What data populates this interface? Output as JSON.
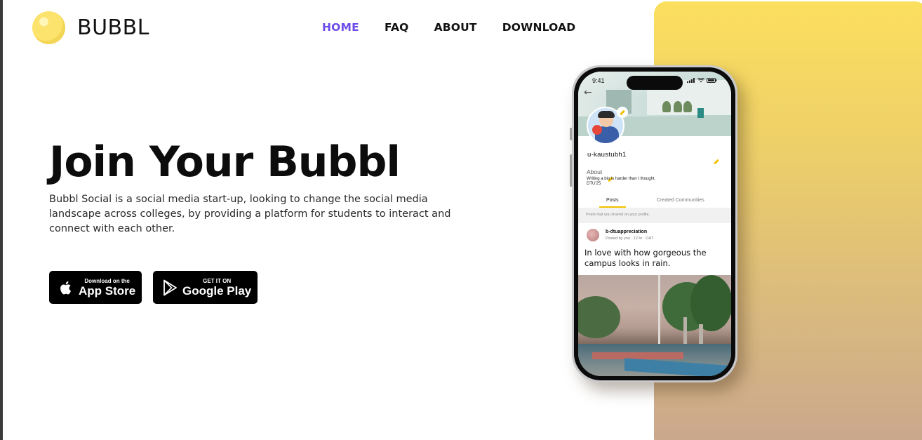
{
  "brand": {
    "name": "BUBBL",
    "accent": "#6c4be8",
    "panel_top": "#fbdf5e",
    "panel_bottom": "#c9a68e"
  },
  "nav": {
    "items": [
      {
        "label": "HOME",
        "active": true
      },
      {
        "label": "FAQ",
        "active": false
      },
      {
        "label": "ABOUT",
        "active": false
      },
      {
        "label": "DOWNLOAD",
        "active": false
      }
    ]
  },
  "hero": {
    "title": "Join Your Bubbl",
    "description": "Bubbl Social is a social media start-up, looking to change the social media landscape across colleges, by providing a platform for students to interact and connect with each other."
  },
  "stores": {
    "apple": {
      "small": "Download on the",
      "big": "App Store",
      "icon": "apple-icon"
    },
    "google": {
      "small": "GET IT ON",
      "big": "Google Play",
      "icon": "google-play-icon"
    }
  },
  "phone": {
    "status_time": "9:41",
    "username": "u-kaustubh1",
    "about_label": "About",
    "bio_line1": "Writing a bio is harder than I thought.",
    "bio_line2": "DTU'25",
    "tabs": {
      "posts": "Posts",
      "communities": "Created Communities"
    },
    "tab_hint": "Posts that you shared on your profile.",
    "post": {
      "community": "b-dtuappreciation",
      "meta": "Posted by you · 12 hr · OAT",
      "text": "In love with how gorgeous the campus looks in rain."
    }
  }
}
